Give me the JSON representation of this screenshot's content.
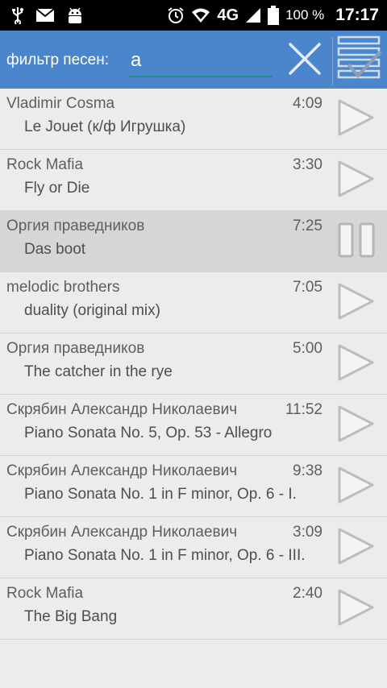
{
  "status_bar": {
    "icons_left": [
      "usb-icon",
      "mail-icon",
      "android-icon"
    ],
    "icons_right": [
      "alarm-icon",
      "wifi-icon",
      "signal-icon",
      "battery-icon"
    ],
    "network": "4G",
    "battery": "100 %",
    "time": "17:17"
  },
  "filter": {
    "label": "фильтр песен:",
    "value": "а",
    "accent_color": "#4b86cc"
  },
  "songs": [
    {
      "artist": "Vladimir Cosma",
      "title": "Le Jouet (к/ф Игрушка)",
      "duration": "4:09",
      "state": "play"
    },
    {
      "artist": "Rock Mafia",
      "title": "Fly or Die",
      "duration": "3:30",
      "state": "play"
    },
    {
      "artist": "Оргия праведников",
      "title": "Das boot",
      "duration": "7:25",
      "state": "pause"
    },
    {
      "artist": "melodic brothers",
      "title": "duality (original mix)",
      "duration": "7:05",
      "state": "play"
    },
    {
      "artist": "Оргия праведников",
      "title": "The catcher in the rye",
      "duration": "5:00",
      "state": "play"
    },
    {
      "artist": "Скрябин Александр Николаевич",
      "title": "Piano Sonata No. 5, Op. 53 - Allegro",
      "duration": "11:52",
      "state": "play"
    },
    {
      "artist": "Скрябин Александр Николаевич",
      "title": "Piano Sonata No. 1 in F minor, Op. 6 - I.",
      "duration": "9:38",
      "state": "play"
    },
    {
      "artist": "Скрябин Александр Николаевич",
      "title": "Piano Sonata No. 1 in F minor, Op. 6 - III.",
      "duration": "3:09",
      "state": "play"
    },
    {
      "artist": "Rock Mafia",
      "title": "The Big Bang",
      "duration": "2:40",
      "state": "play"
    }
  ]
}
